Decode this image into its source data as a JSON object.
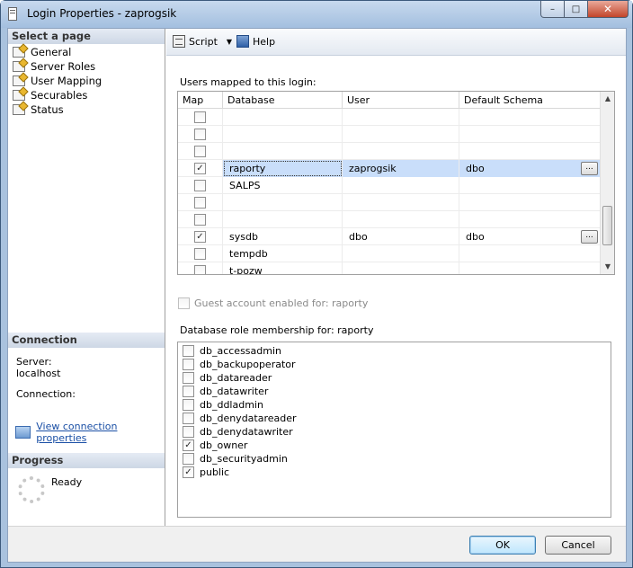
{
  "window": {
    "title": "Login Properties - zaprogsik",
    "controls": {
      "minimize": "–",
      "maximize": "□",
      "close": "✕"
    }
  },
  "left_pane": {
    "select_page_header": "Select a page",
    "pages": [
      {
        "label": "General",
        "icon": "page-icon"
      },
      {
        "label": "Server Roles",
        "icon": "page-icon"
      },
      {
        "label": "User Mapping",
        "icon": "page-icon"
      },
      {
        "label": "Securables",
        "icon": "page-icon"
      },
      {
        "label": "Status",
        "icon": "page-icon"
      }
    ],
    "connection_header": "Connection",
    "server_label": "Server:",
    "server_value": "localhost",
    "connection_label": "Connection:",
    "connection_value": "",
    "view_connection_link": "View connection properties",
    "progress_header": "Progress",
    "progress_status": "Ready"
  },
  "toolbar": {
    "script_label": "Script",
    "script_dropdown": "▼",
    "help_label": "Help"
  },
  "user_mapping": {
    "label": "Users mapped to this login:",
    "columns": [
      "Map",
      "Database",
      "User",
      "Default Schema"
    ],
    "rows": [
      {
        "checked": false,
        "database": "",
        "user": "",
        "schema": "",
        "selected": false,
        "has_button": false
      },
      {
        "checked": false,
        "database": "",
        "user": "",
        "schema": "",
        "selected": false,
        "has_button": false
      },
      {
        "checked": false,
        "database": "",
        "user": "",
        "schema": "",
        "selected": false,
        "has_button": false
      },
      {
        "checked": true,
        "database": "raporty",
        "user": "zaprogsik",
        "schema": "dbo",
        "selected": true,
        "has_button": true
      },
      {
        "checked": false,
        "database": "SALPS",
        "user": "",
        "schema": "",
        "selected": false,
        "has_button": false
      },
      {
        "checked": false,
        "database": "",
        "user": "",
        "schema": "",
        "selected": false,
        "has_button": false
      },
      {
        "checked": false,
        "database": "",
        "user": "",
        "schema": "",
        "selected": false,
        "has_button": false
      },
      {
        "checked": true,
        "database": "sysdb",
        "user": "dbo",
        "schema": "dbo",
        "selected": false,
        "has_button": true
      },
      {
        "checked": false,
        "database": "tempdb",
        "user": "",
        "schema": "",
        "selected": false,
        "has_button": false
      },
      {
        "checked": false,
        "database": "t-pozw",
        "user": "",
        "schema": "",
        "selected": false,
        "has_button": false
      }
    ],
    "ellipsis_label": "...",
    "scroll_up": "▲",
    "scroll_down": "▼"
  },
  "guest": {
    "label": "Guest account enabled for: raporty",
    "checked": false
  },
  "role_membership": {
    "label": "Database role membership for: raporty",
    "roles": [
      {
        "name": "db_accessadmin",
        "checked": false
      },
      {
        "name": "db_backupoperator",
        "checked": false
      },
      {
        "name": "db_datareader",
        "checked": false
      },
      {
        "name": "db_datawriter",
        "checked": false
      },
      {
        "name": "db_ddladmin",
        "checked": false
      },
      {
        "name": "db_denydatareader",
        "checked": false
      },
      {
        "name": "db_denydatawriter",
        "checked": false
      },
      {
        "name": "db_owner",
        "checked": true
      },
      {
        "name": "db_securityadmin",
        "checked": false
      },
      {
        "name": "public",
        "checked": true
      }
    ]
  },
  "buttons": {
    "ok": "OK",
    "cancel": "Cancel"
  },
  "colors": {
    "selection": "#c9defa",
    "link": "#1a4fa5",
    "frame": "#a9c2de"
  }
}
